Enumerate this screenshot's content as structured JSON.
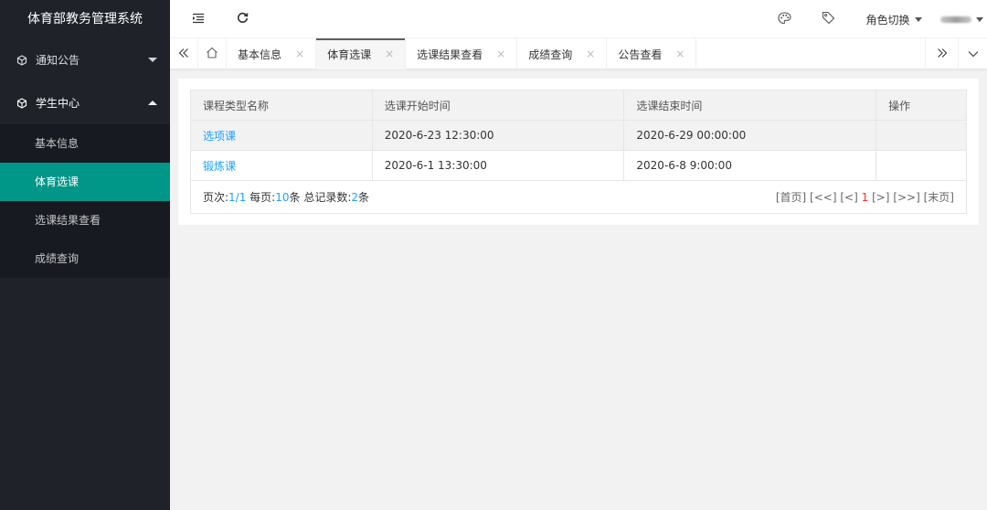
{
  "app": {
    "title": "体育部教务管理系统"
  },
  "sidebar": {
    "groups": [
      {
        "label": "通知公告",
        "icon": "cube-icon",
        "expanded": false
      },
      {
        "label": "学生中心",
        "icon": "cube-icon",
        "expanded": true,
        "items": [
          {
            "label": "基本信息"
          },
          {
            "label": "体育选课",
            "active": true
          },
          {
            "label": "选课结果查看"
          },
          {
            "label": "成绩查询"
          }
        ]
      }
    ]
  },
  "header": {
    "role_switch": "角色切换"
  },
  "tabs": {
    "items": [
      {
        "label": "基本信息"
      },
      {
        "label": "体育选课",
        "active": true
      },
      {
        "label": "选课结果查看"
      },
      {
        "label": "成绩查询"
      },
      {
        "label": "公告查看"
      }
    ],
    "close_glyph": "×"
  },
  "table": {
    "columns": [
      "课程类型名称",
      "选课开始时间",
      "选课结束时间",
      "操作"
    ],
    "rows": [
      {
        "name": "选项课",
        "start": "2020-6-23 12:30:00",
        "end": "2020-6-29 00:00:00",
        "action": ""
      },
      {
        "name": "锻炼课",
        "start": "2020-6-1 13:30:00",
        "end": "2020-6-8 9:00:00",
        "action": ""
      }
    ]
  },
  "pager": {
    "page_label": "页次:",
    "page_value": "1/1",
    "per_page_label": " 每页:",
    "per_page_value": "10",
    "per_page_unit": "条 总记录数:",
    "total_value": "2",
    "total_unit": "条",
    "first": "[首页]",
    "prev_prev": "[<<]",
    "prev": "[<]",
    "current": "1",
    "next": "[>]",
    "next_next": "[>>]",
    "last": "[末页]"
  },
  "colors": {
    "accent": "#009688",
    "link": "#1e9fff",
    "current_page": "#ff2b2b",
    "sidebar_bg": "#20222a"
  }
}
